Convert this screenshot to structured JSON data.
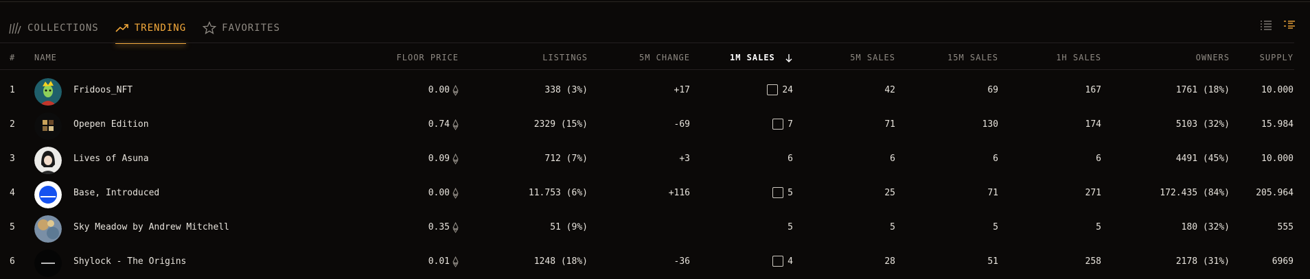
{
  "tabs": [
    {
      "label": "COLLECTIONS",
      "icon": "collections-icon",
      "active": false
    },
    {
      "label": "TRENDING",
      "icon": "trending-icon",
      "active": true
    },
    {
      "label": "FAVORITES",
      "icon": "star-icon",
      "active": false
    }
  ],
  "view_toggle": {
    "list": "list-view-icon",
    "detail": "detail-list-icon",
    "active": "detail"
  },
  "columns": {
    "index": "#",
    "name": "NAME",
    "floor_price": "FLOOR PRICE",
    "listings": "LISTINGS",
    "change_5m": "5M CHANGE",
    "sales_1m": "1M SALES",
    "sales_5m": "5M SALES",
    "sales_15m": "15M SALES",
    "sales_1h": "1H SALES",
    "owners": "OWNERS",
    "supply": "SUPPLY"
  },
  "sort": {
    "column": "sales_1m",
    "direction": "desc"
  },
  "colors": {
    "accent": "#f3a93b",
    "background": "#0b0908",
    "text": "#e7e3dc",
    "muted": "#8f8a83"
  },
  "rows": [
    {
      "index": "1",
      "name": "Fridoos_NFT",
      "floor": "0.00",
      "listings": "338 (3%)",
      "change": "+17",
      "sales_1m": "24",
      "sales_5m": "42",
      "sales_15m": "69",
      "sales_1h": "167",
      "owners": "1761 (18%)",
      "supply": "10.000"
    },
    {
      "index": "2",
      "name": "Opepen Edition",
      "floor": "0.74",
      "listings": "2329 (15%)",
      "change": "-69",
      "sales_1m": "7",
      "sales_5m": "71",
      "sales_15m": "130",
      "sales_1h": "174",
      "owners": "5103 (32%)",
      "supply": "15.984"
    },
    {
      "index": "3",
      "name": "Lives of Asuna",
      "floor": "0.09",
      "listings": "712 (7%)",
      "change": "+3",
      "sales_1m": "6",
      "sales_5m": "6",
      "sales_15m": "6",
      "sales_1h": "6",
      "owners": "4491 (45%)",
      "supply": "10.000"
    },
    {
      "index": "4",
      "name": "Base, Introduced",
      "floor": "0.00",
      "listings": "11.753 (6%)",
      "change": "+116",
      "sales_1m": "5",
      "sales_5m": "25",
      "sales_15m": "71",
      "sales_1h": "271",
      "owners": "172.435 (84%)",
      "supply": "205.964"
    },
    {
      "index": "5",
      "name": "Sky Meadow by Andrew Mitchell",
      "floor": "0.35",
      "listings": "51 (9%)",
      "change": "",
      "sales_1m": "5",
      "sales_5m": "5",
      "sales_15m": "5",
      "sales_1h": "5",
      "owners": "180 (32%)",
      "supply": "555"
    },
    {
      "index": "6",
      "name": "Shylock - The Origins",
      "floor": "0.01",
      "listings": "1248 (18%)",
      "change": "-36",
      "sales_1m": "4",
      "sales_5m": "28",
      "sales_15m": "51",
      "sales_1h": "258",
      "owners": "2178 (31%)",
      "supply": "6969"
    }
  ]
}
